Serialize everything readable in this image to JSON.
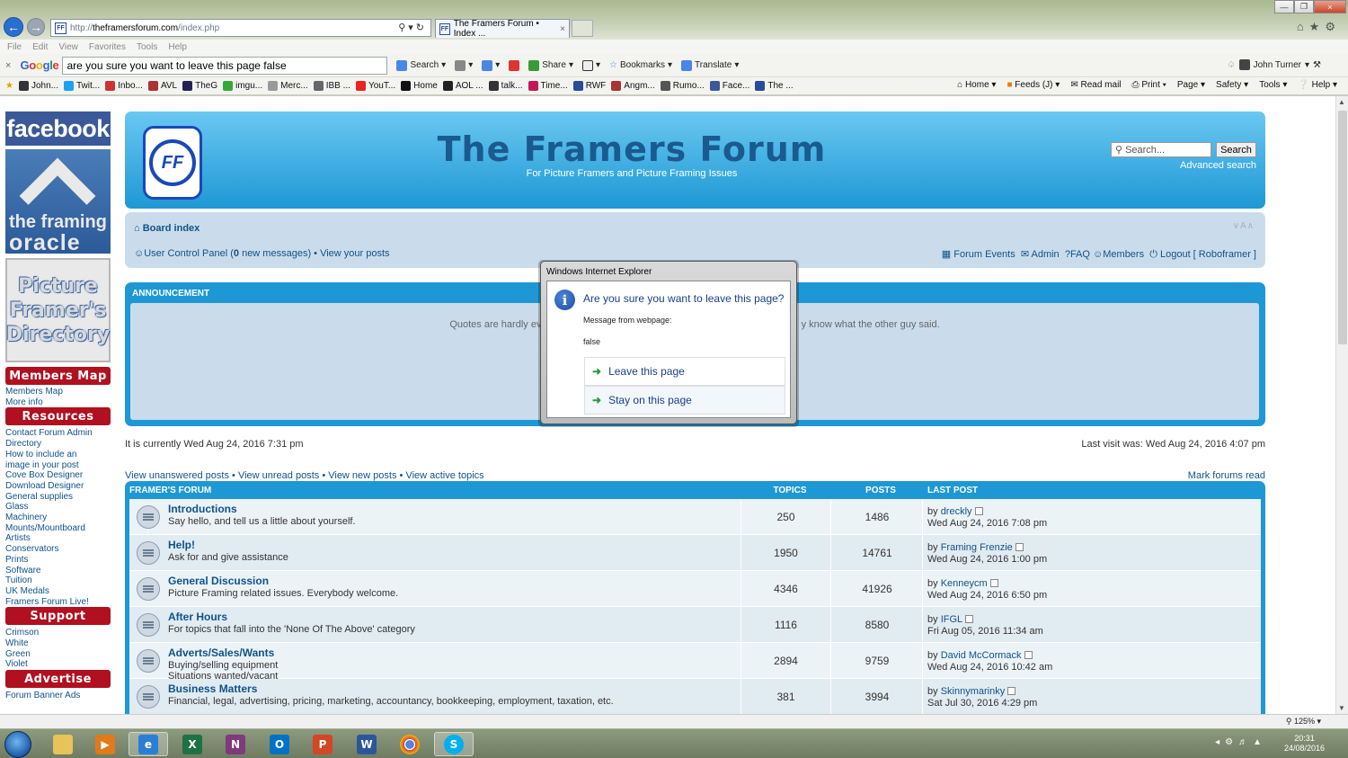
{
  "browser": {
    "address": "http://theframersforum.com/index.php",
    "address_host": "theframersforum.com",
    "address_prefix": "http://",
    "address_suffix": "/index.php",
    "tab_title": "The Framers Forum • Index ...",
    "menu": [
      "File",
      "Edit",
      "View",
      "Favorites",
      "Tools",
      "Help"
    ],
    "google_query": "are you sure you want to leave this page false",
    "google_logo": "Google",
    "toolbar": {
      "search": "Search",
      "share": "Share",
      "bookmarks": "Bookmarks",
      "translate": "Translate",
      "user": "John Turner"
    },
    "favorites": [
      "John...",
      "Twit...",
      "Inbo...",
      "AVL",
      "TheG",
      "imgu...",
      "Merc...",
      "IBB ...",
      "YouT...",
      "Home",
      "AOL ...",
      "talk...",
      "Time...",
      "RWF",
      "Angm...",
      "Rumo...",
      "Face...",
      "The ..."
    ],
    "command_bar": {
      "home": "Home",
      "feeds": "Feeds (J)",
      "read_mail": "Read mail",
      "print": "Print",
      "page": "Page",
      "safety": "Safety",
      "tools": "Tools",
      "help": "Help"
    },
    "zoom": "125%"
  },
  "sidebar": {
    "facebook": "facebook",
    "oracle_line1": "the framing",
    "oracle_line2": "oracle",
    "directory_lines": [
      "Picture",
      "Framer's",
      "Directory"
    ],
    "members_map_header": "Members Map",
    "members_links": [
      "Members Map",
      "More info"
    ],
    "resources_header": "Resources",
    "resources_links": [
      "Contact Forum Admin",
      "Directory",
      "How to include an",
      "image in your post",
      "Cove Box Designer",
      "Download Designer",
      "General supplies",
      "Glass",
      "Machinery",
      "Mounts/Mountboard",
      "Artists",
      "Conservators",
      "Prints",
      "Software",
      "Tuition",
      "UK Medals",
      "Framers Forum Live!"
    ],
    "support_header": "Support",
    "support_links": [
      "Crimson",
      "White",
      "Green",
      "Violet"
    ],
    "advertise_header": "Advertise",
    "advertise_links": [
      "Forum Banner Ads"
    ]
  },
  "forum": {
    "logo_text": "FF",
    "title": "The Framers Forum",
    "description": "For Picture Framers and Picture Framing Issues",
    "search_placeholder": "Search...",
    "search_button": "Search",
    "advanced_search": "Advanced search",
    "board_index": "Board index",
    "font_size_control": "∨A∧",
    "ucp_prefix": "User Control Panel (",
    "ucp_count": "0",
    "ucp_suffix": " new messages)",
    "view_posts": "View your posts",
    "nav_right": [
      "Forum Events",
      "Admin",
      "FAQ",
      "Members",
      "Logout [ Roboframer ]"
    ],
    "announcement_header": "ANNOUNCEMENT",
    "announcement_left": "Quotes are hardly eve",
    "announcement_right": "y know what the other guy said.",
    "current_time": "It is currently Wed Aug 24, 2016 7:31 pm",
    "last_visit": "Last visit was: Wed Aug 24, 2016 4:07 pm",
    "search_links": [
      "View unanswered posts",
      "View unread posts",
      "View new posts",
      "View active topics"
    ],
    "mark_read": "Mark forums read",
    "section_header": "FRAMER'S FORUM",
    "col_topics": "TOPICS",
    "col_posts": "POSTS",
    "col_last": "LAST POST",
    "rows": [
      {
        "title": "Introductions",
        "desc": "Say hello, and tell us a little about yourself.",
        "desc2": "",
        "topics": "250",
        "posts": "1486",
        "last_by": "dreckly",
        "last_time": "Wed Aug 24, 2016 7:08 pm"
      },
      {
        "title": "Help!",
        "desc": "Ask for and give assistance",
        "desc2": "",
        "topics": "1950",
        "posts": "14761",
        "last_by": "Framing Frenzie",
        "last_time": "Wed Aug 24, 2016 1:00 pm"
      },
      {
        "title": "General Discussion",
        "desc": "Picture Framing related issues. Everybody welcome.",
        "desc2": "",
        "topics": "4346",
        "posts": "41926",
        "last_by": "Kenneycm",
        "last_time": "Wed Aug 24, 2016 6:50 pm"
      },
      {
        "title": "After Hours",
        "desc": "For topics that fall into the 'None Of The Above' category",
        "desc2": "",
        "topics": "1116",
        "posts": "8580",
        "last_by": "IFGL",
        "last_time": "Fri Aug 05, 2016 11:34 am"
      },
      {
        "title": "Adverts/Sales/Wants",
        "desc": "Buying/selling equipment",
        "desc2": "Situations wanted/vacant",
        "topics": "2894",
        "posts": "9759",
        "last_by": "David McCormack",
        "last_time": "Wed Aug 24, 2016 10:42 am"
      },
      {
        "title": "Business Matters",
        "desc": "Financial, legal, advertising, pricing, marketing, accountancy, bookkeeping, employment, taxation, etc.",
        "desc2": "",
        "topics": "381",
        "posts": "3994",
        "last_by": "Skinnymarinky",
        "last_time": "Sat Jul 30, 2016 4:29 pm"
      }
    ]
  },
  "dialog": {
    "title": "Windows Internet Explorer",
    "question": "Are you sure you want to leave this page?",
    "message_label": "Message from webpage:",
    "message_value": "false",
    "leave": "Leave this page",
    "stay": "Stay on this page"
  },
  "taskbar": {
    "time": "20:31",
    "date": "24/08/2016"
  }
}
